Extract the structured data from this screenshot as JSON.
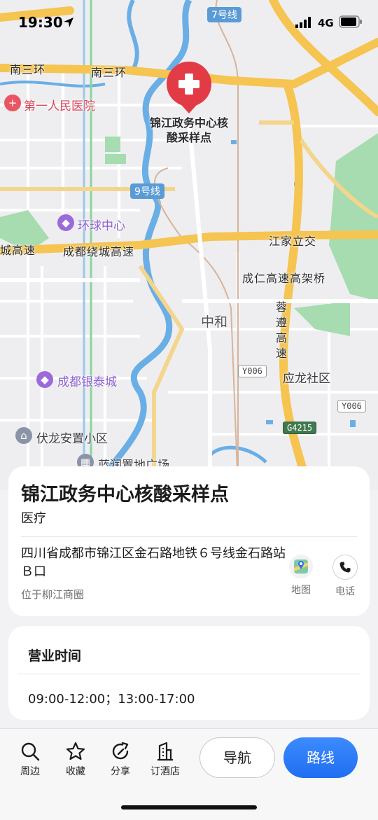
{
  "status_bar": {
    "time": "19:30",
    "network": "4G"
  },
  "map": {
    "pin_label": "锦江政务中心核\n酸采样点",
    "labels": {
      "nansanhuan_left": "南三环",
      "nansanhuan_mid": "南三环",
      "hospital": "第一人民医院",
      "huanqiu": "环球中心",
      "chengdu_ring_left": "城高速",
      "chengdu_ring": "成都绕城高速",
      "jiangjia": "江家立交",
      "chengren": "成仁高速高架桥",
      "zhonghe": "中和",
      "rongzun": "蓉遵高速",
      "yintai": "成都银泰城",
      "yinglong": "应龙社区",
      "fulong": "伏龙安置小区",
      "lanrun": "蓝润置地广场"
    },
    "shields": {
      "line7": "7号线",
      "line9": "9号线",
      "y006a": "Y006",
      "y006b": "Y006",
      "g4215": "G4215"
    }
  },
  "place": {
    "name": "锦江政务中心核酸采样点",
    "category": "医疗",
    "address": "四川省成都市锦江区金石路地铁６号线金石路站Ｂ口",
    "area": "位于柳江商圈",
    "actions": {
      "map": "地图",
      "phone": "电话"
    }
  },
  "hours": {
    "title": "营业时间",
    "value": "09:00-12:00；13:00-17:00"
  },
  "toolbar": {
    "nearby": "周边",
    "favorite": "收藏",
    "share": "分享",
    "hotel": "订酒店",
    "navigate": "导航",
    "route": "路线"
  },
  "colors": {
    "accent": "#1f6ef2",
    "pin": "#e23b45",
    "highway": "#f5c451",
    "river": "#5ba7e0",
    "park": "#8fd19a"
  }
}
